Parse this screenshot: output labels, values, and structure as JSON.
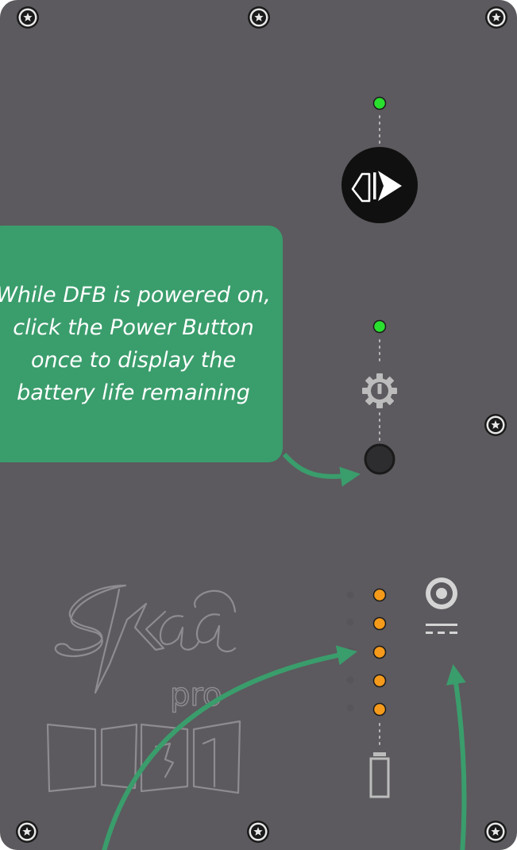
{
  "callout": {
    "text": "While DFB is powered on, click the Power Button once to display the battery life remaining"
  },
  "panel": {
    "color": "#5c5a5e",
    "logo_text": "Skaa",
    "logo_sub": "pro"
  },
  "indicators": {
    "mode_led_color": "#29e02e",
    "power_led_color": "#29e02e",
    "battery_led_color": "#f59a1b",
    "battery_levels_lit": 5,
    "battery_levels_total": 5
  },
  "icons": {
    "mode_button": "bluetooth-mode-icon",
    "power_symbol": "power-gear-icon",
    "power_button": "power-button",
    "battery": "battery-icon",
    "charging_port": "dc-charging-port-icon",
    "screw": "screw-icon"
  },
  "colors": {
    "callout": "#3a9d6c",
    "arrow": "#3a9d6c"
  }
}
